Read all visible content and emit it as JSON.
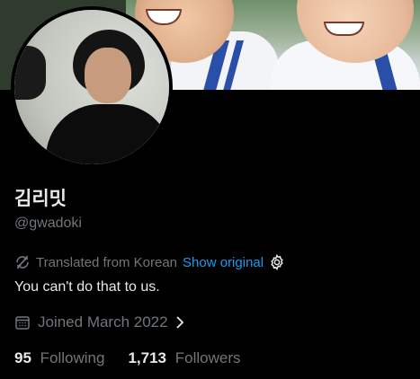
{
  "profile": {
    "display_name": "김리밋",
    "handle": "@gwadoki",
    "translation": {
      "note": "Translated from Korean",
      "show_original_label": "Show original"
    },
    "bio": "You can't do that to us.",
    "joined": "Joined March 2022",
    "following": {
      "count": "95",
      "label": "Following"
    },
    "followers": {
      "count": "1,713",
      "label": "Followers"
    }
  },
  "icons": {
    "translate": "translate-icon",
    "settings": "gear-icon",
    "calendar": "calendar-icon",
    "chevron": "chevron-right-icon"
  },
  "colors": {
    "background": "#000000",
    "primary_text": "#e7e9ea",
    "secondary_text": "#71767b",
    "link": "#1d9bf0"
  }
}
